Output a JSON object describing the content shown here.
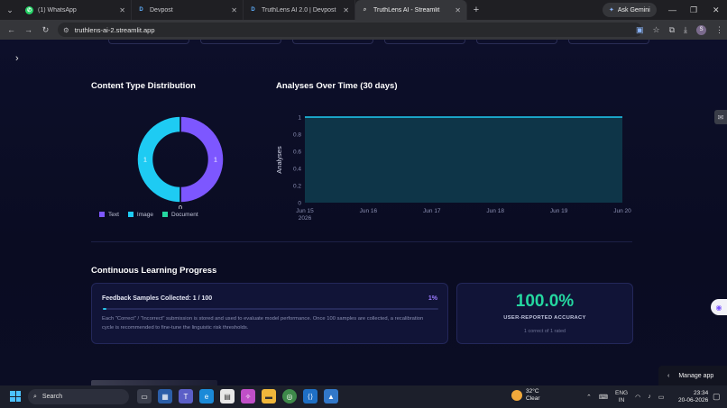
{
  "browser": {
    "tabs": [
      {
        "title": "(1) WhatsApp",
        "icon": "whatsapp-icon",
        "active": false
      },
      {
        "title": "Devpost",
        "icon": "devpost-icon",
        "active": false
      },
      {
        "title": "TruthLens AI 2.0 | Devpost",
        "icon": "devpost-icon",
        "active": false
      },
      {
        "title": "TruthLens AI - Streamlit",
        "icon": "search-icon",
        "active": true
      }
    ],
    "ask_gemini": "Ask Gemini",
    "url": "truthlens-ai-2.streamlit.app",
    "profile_initial": "S"
  },
  "content_distribution": {
    "title": "Content Type Distribution",
    "slice_labels": [
      "1",
      "1"
    ],
    "zero_label": "0",
    "legend": [
      {
        "label": "Text",
        "color": "#7d57ff"
      },
      {
        "label": "Image",
        "color": "#1ecbf3"
      },
      {
        "label": "Document",
        "color": "#25d7a0"
      }
    ]
  },
  "analyses_over_time": {
    "title": "Analyses Over Time (30 days)"
  },
  "chart_data": [
    {
      "type": "pie",
      "title": "Content Type Distribution",
      "categories": [
        "Text",
        "Image",
        "Document"
      ],
      "values": [
        1,
        1,
        0
      ],
      "colors": [
        "#7d57ff",
        "#1ecbf3",
        "#25d7a0"
      ],
      "donut": true,
      "legend": "bottom"
    },
    {
      "type": "area",
      "title": "Analyses Over Time (30 days)",
      "ylabel": "Analyses",
      "xlabel": "",
      "x": [
        "2026-06-15",
        "2026-06-20"
      ],
      "values": [
        1,
        1
      ],
      "ylim": [
        0,
        1
      ],
      "yticks": [
        "0",
        "0.2",
        "0.4",
        "0.6",
        "0.8",
        "1"
      ],
      "xticks": [
        "Jun 15",
        "Jun 16",
        "Jun 17",
        "Jun 18",
        "Jun 19",
        "Jun 20"
      ],
      "xtick_year": "2026",
      "line_color": "#1ecbf3",
      "fill_color": "#0e3a4c"
    }
  ],
  "learning": {
    "title": "Continuous Learning Progress",
    "feedback_label": "Feedback Samples Collected: 1 / 100",
    "percent_text": "1%",
    "progress": 0.01,
    "description": "Each \"Correct\" / \"Incorrect\" submission is stored and used to evaluate model performance. Once 100 samples are collected, a recalibration cycle is recommended to fine-tune the linguistic risk thresholds.",
    "accuracy_value": "100.0%",
    "accuracy_label": "USER-REPORTED ACCURACY",
    "accuracy_sub": "1 correct of 1 rated"
  },
  "app": {
    "manage_app": "Manage app"
  },
  "taskbar": {
    "search_placeholder": "Search",
    "weather_temp": "32°C",
    "weather_desc": "Clear",
    "lang_line1": "ENG",
    "lang_line2": "IN",
    "time": "23:34",
    "date": "20-06-2026"
  }
}
